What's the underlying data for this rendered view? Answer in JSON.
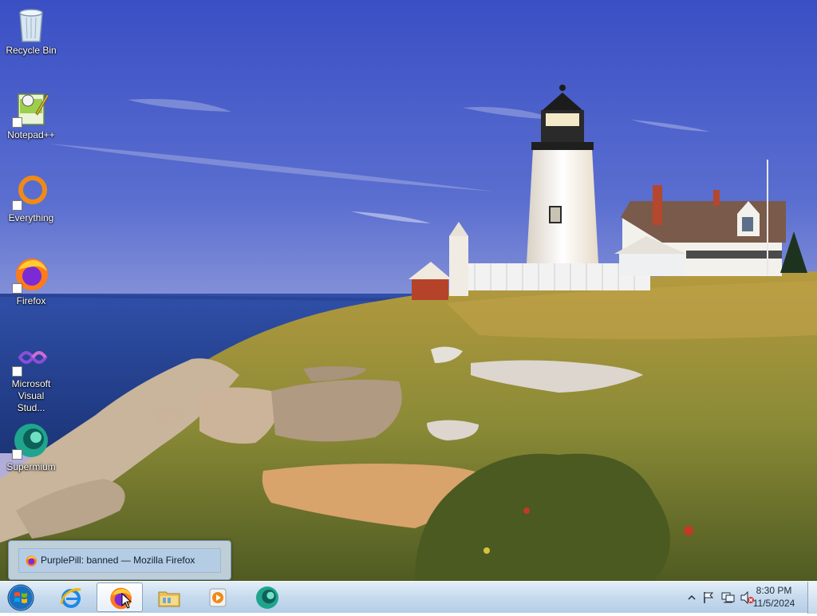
{
  "desktop": {
    "icons": [
      {
        "label": "Recycle Bin",
        "icon": "recycle-bin-icon"
      },
      {
        "label": "Notepad++",
        "icon": "notepadpp-icon"
      },
      {
        "label": "Everything",
        "icon": "everything-icon"
      },
      {
        "label": "Firefox",
        "icon": "firefox-icon"
      },
      {
        "label": "Microsoft Visual Stud...",
        "icon": "visual-studio-icon"
      },
      {
        "label": "Supermium",
        "icon": "supermium-icon"
      }
    ]
  },
  "taskbar": {
    "pinned": [
      {
        "name": "Internet Explorer",
        "icon": "internet-explorer-icon",
        "active": false
      },
      {
        "name": "Firefox",
        "icon": "firefox-icon",
        "active": true
      },
      {
        "name": "Windows Explorer",
        "icon": "folder-icon",
        "active": false
      },
      {
        "name": "Media Player",
        "icon": "media-player-icon",
        "active": false
      },
      {
        "name": "Supermium",
        "icon": "supermium-icon",
        "active": false
      }
    ],
    "preview_title": "PurplePill: banned — Mozilla Firefox",
    "clock": {
      "time": "8:30 PM",
      "date": "11/5/2024"
    },
    "tray_icons": [
      "show-hidden-icons-chevron",
      "action-center-flag-icon",
      "network-icon",
      "volume-muted-icon"
    ]
  },
  "colors": {
    "taskbar_top": "#e3eef9",
    "taskbar_bottom": "#b4cde6",
    "sky": "#4a5fc8"
  }
}
